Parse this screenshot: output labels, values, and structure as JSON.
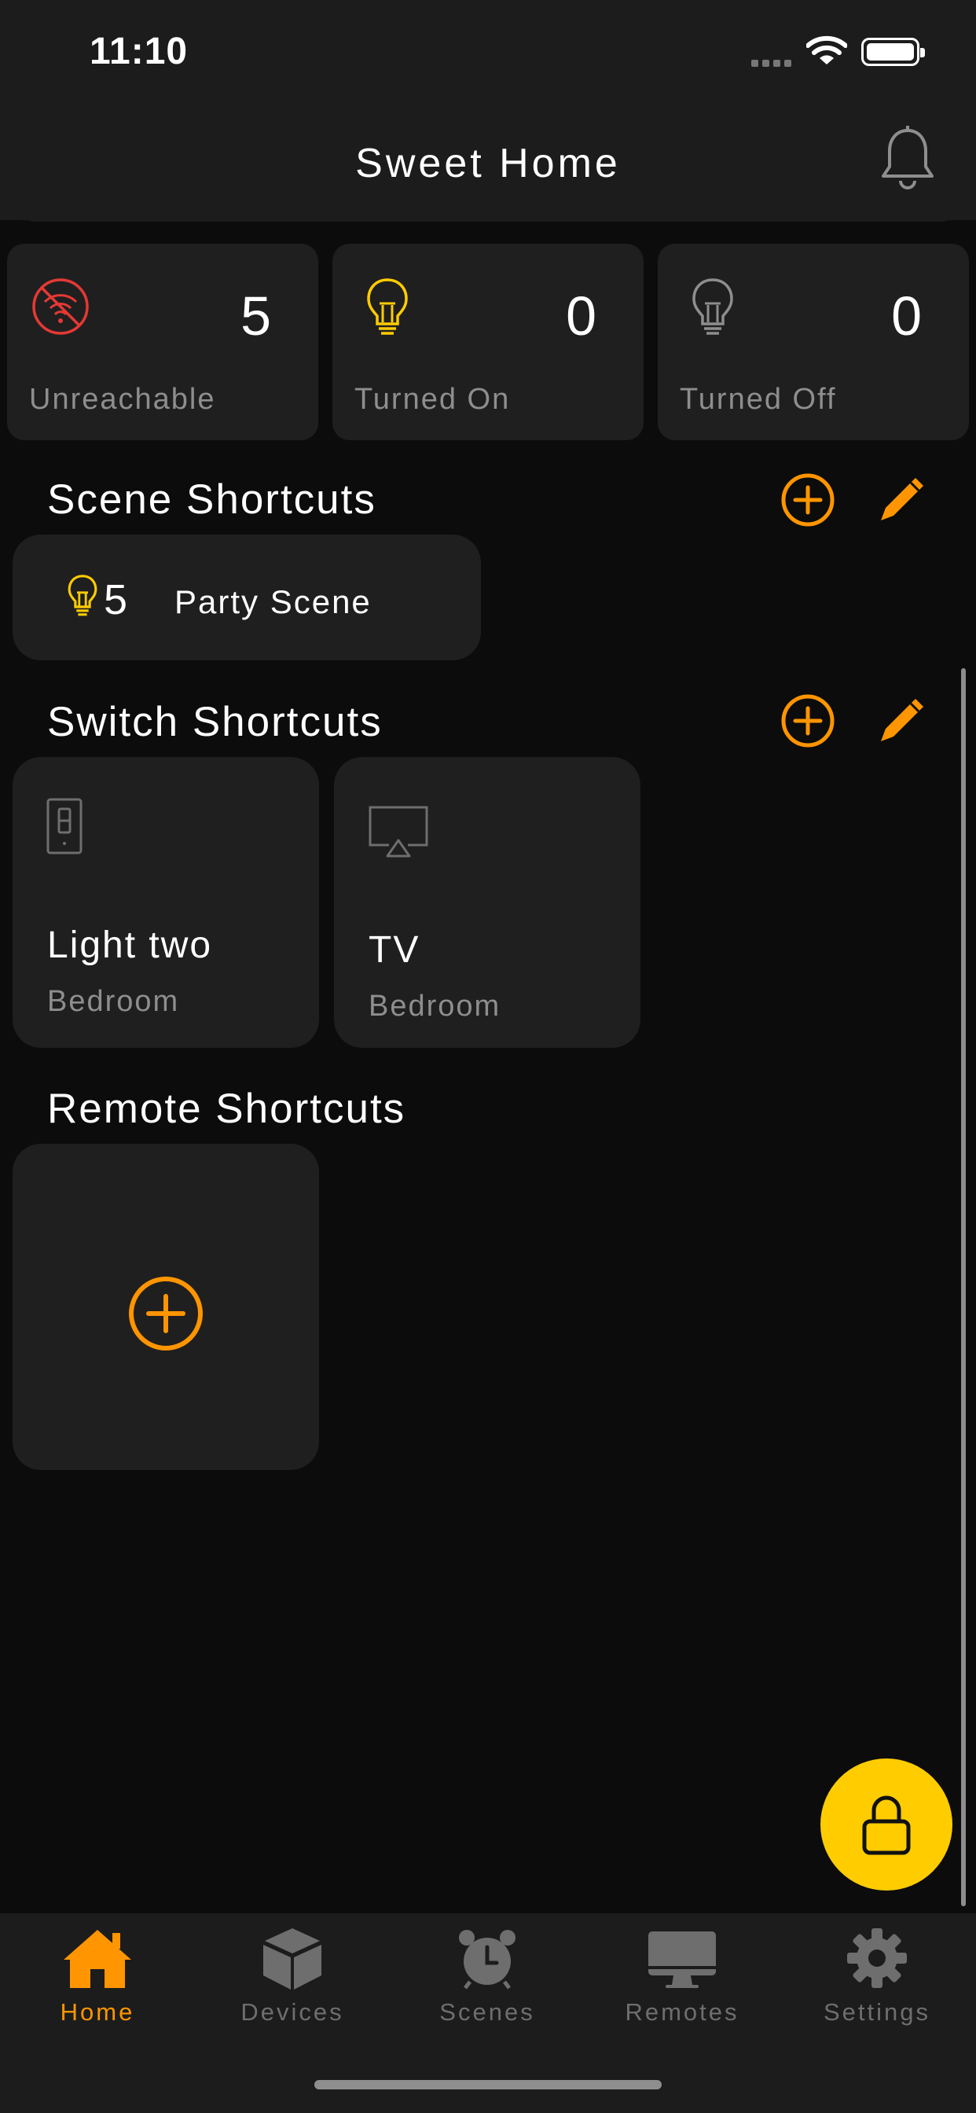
{
  "status_bar": {
    "time": "11:10"
  },
  "header": {
    "title": "Sweet Home",
    "bell_icon": "bell-icon"
  },
  "stats": [
    {
      "icon": "wifi-off-icon",
      "count": "5",
      "label": "Unreachable",
      "color": "#e53935"
    },
    {
      "icon": "lightbulb-on-icon",
      "count": "0",
      "label": "Turned On",
      "color": "#ffcc00"
    },
    {
      "icon": "lightbulb-off-icon",
      "count": "0",
      "label": "Turned Off",
      "color": "#8e8e8e"
    }
  ],
  "scene_shortcuts": {
    "title": "Scene Shortcuts",
    "items": [
      {
        "count": "5",
        "name": "Party Scene",
        "icon": "lightbulb-icon"
      }
    ]
  },
  "switch_shortcuts": {
    "title": "Switch Shortcuts",
    "items": [
      {
        "name": "Light two",
        "room": "Bedroom",
        "icon": "light-switch-icon"
      },
      {
        "name": "TV",
        "room": "Bedroom",
        "icon": "airplay-tv-icon"
      }
    ]
  },
  "remote_shortcuts": {
    "title": "Remote Shortcuts"
  },
  "fab": {
    "icon": "lock-icon"
  },
  "tabs": [
    {
      "label": "Home",
      "icon": "home-icon",
      "active": true
    },
    {
      "label": "Devices",
      "icon": "cube-icon",
      "active": false
    },
    {
      "label": "Scenes",
      "icon": "alarm-clock-icon",
      "active": false
    },
    {
      "label": "Remotes",
      "icon": "monitor-icon",
      "active": false
    },
    {
      "label": "Settings",
      "icon": "gear-icon",
      "active": false
    }
  ],
  "colors": {
    "accent": "#ff9500",
    "fab": "#ffcc00",
    "card": "#1f1f1f",
    "background": "#0c0c0c"
  }
}
